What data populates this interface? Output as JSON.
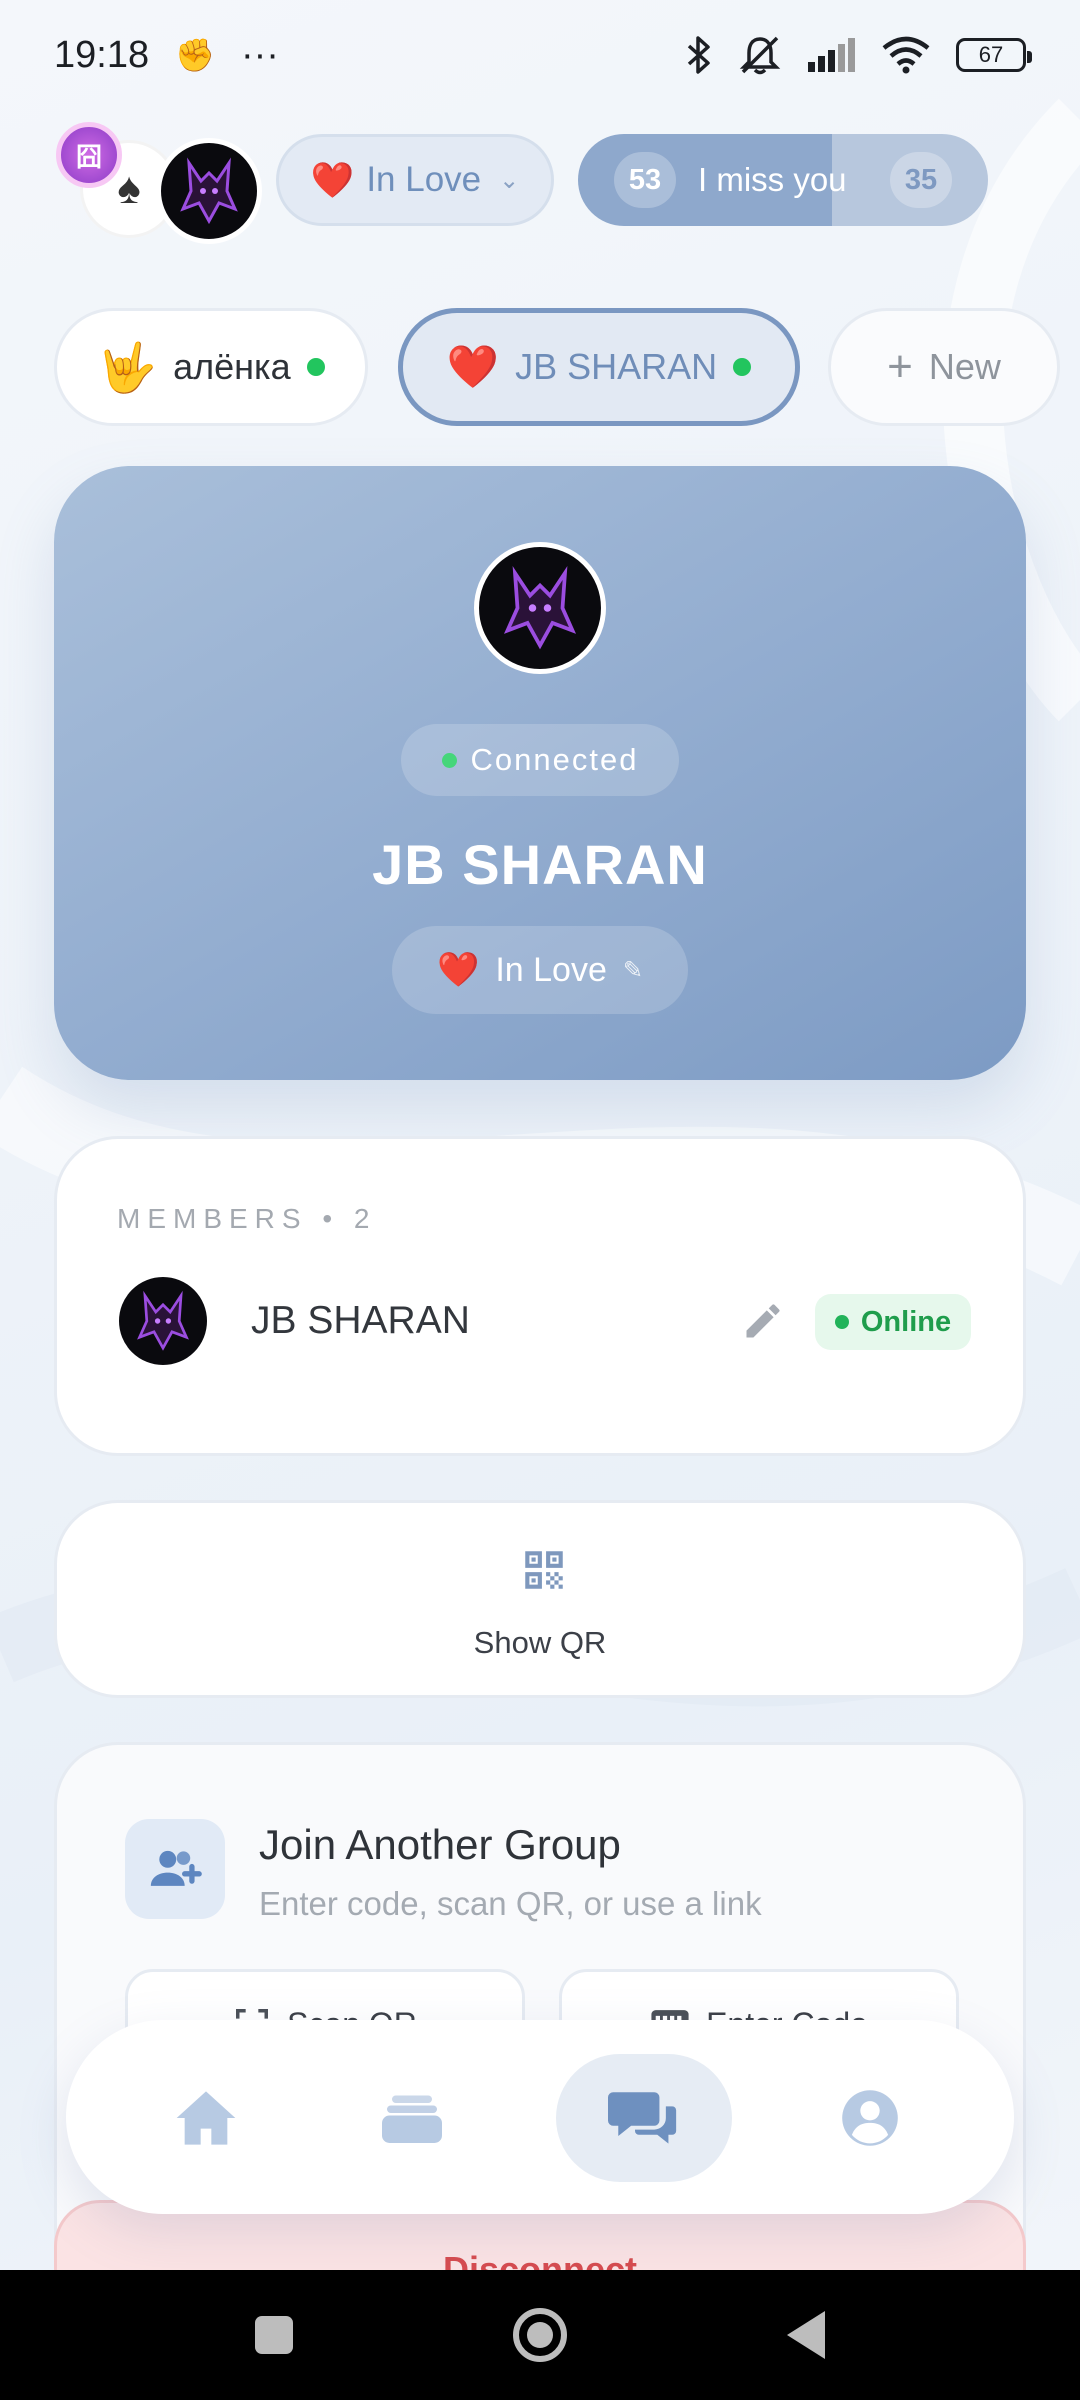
{
  "status_bar": {
    "time": "19:18",
    "more": "···",
    "battery": "67",
    "icons": [
      "hand-icon",
      "bluetooth-icon",
      "bell-muted-icon",
      "signal-icon",
      "wifi-icon",
      "battery-icon"
    ]
  },
  "header": {
    "badge_glyph": "囧",
    "card_glyph": "♠",
    "mood": {
      "emoji": "❤️",
      "label": "In Love",
      "chevron": "⌄"
    },
    "miss_you": {
      "left_count": "53",
      "label": "I miss you",
      "right_count": "35",
      "fill_fraction": 0.62
    }
  },
  "tabs": [
    {
      "emoji": "🤟",
      "label": "алёнка",
      "online": true
    },
    {
      "emoji": "❤️",
      "label": "JB SHARAN",
      "online": true,
      "selected": true
    },
    {
      "icon": "+",
      "label": "New"
    }
  ],
  "hero": {
    "status": "Connected",
    "name": "JB SHARAN",
    "mood_emoji": "❤️",
    "mood_label": "In Love",
    "edit_glyph": "✎"
  },
  "members": {
    "title": "MEMBERS • 2",
    "list": [
      {
        "name": "JB SHARAN",
        "status": "Online"
      }
    ]
  },
  "qr": {
    "label": "Show QR"
  },
  "join": {
    "title": "Join Another Group",
    "subtitle": "Enter code, scan QR, or use a link",
    "scan_label": "Scan QR",
    "enter_label": "Enter Code"
  },
  "disconnect": {
    "label": "Disconnect"
  },
  "bottom_nav": {
    "items": [
      "home-icon",
      "cards-icon",
      "chat-icon",
      "profile-icon"
    ],
    "active": "chat-icon"
  },
  "colors": {
    "accent": "#7a97c1",
    "online": "#22c55e",
    "hero_start": "#a9bfda",
    "hero_end": "#7d9bc4",
    "danger": "#d64b4f"
  }
}
